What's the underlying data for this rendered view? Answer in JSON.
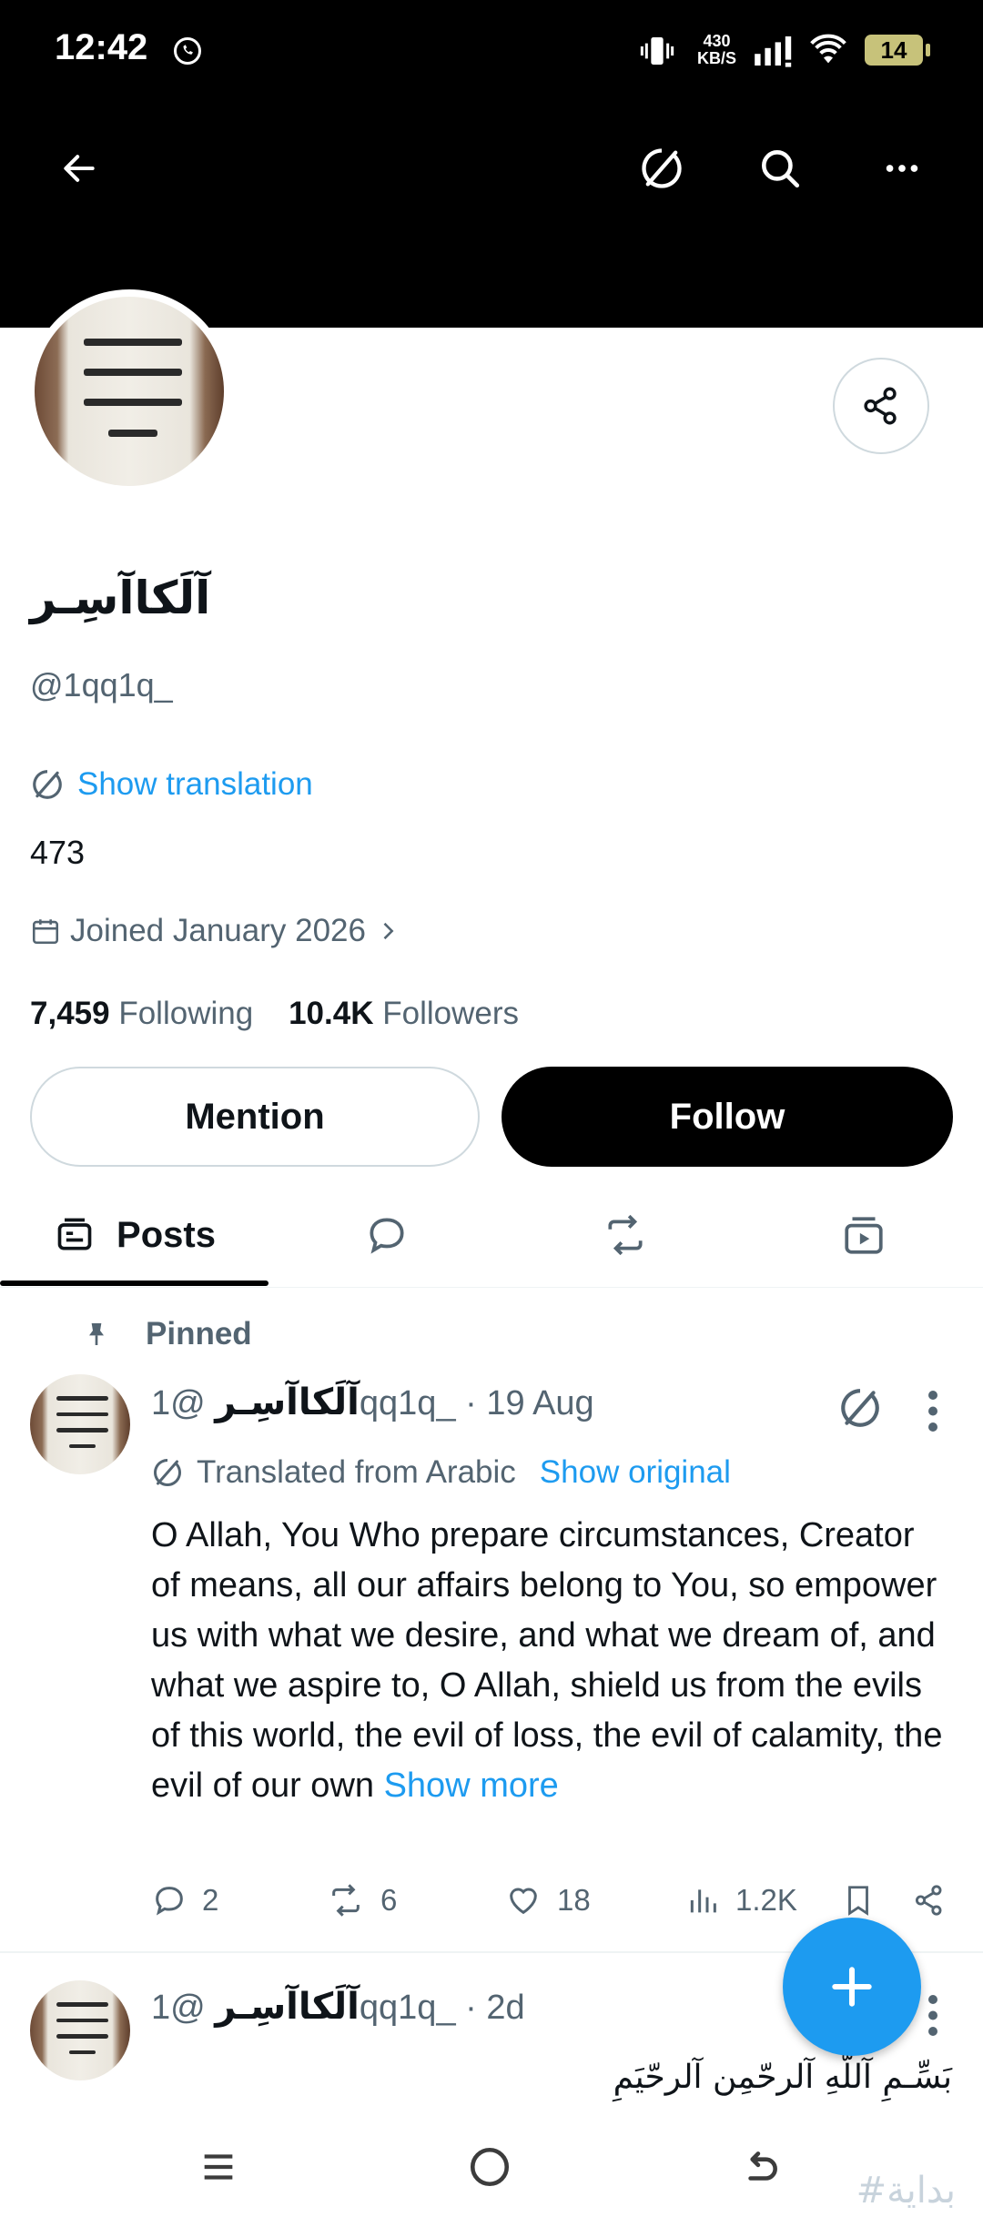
{
  "status_bar": {
    "time": "12:42",
    "net_speed_value": "430",
    "net_speed_unit": "KB/S",
    "battery": "14"
  },
  "profile": {
    "display_name": "آلَكاآسِـر",
    "handle": "@1qq1q_",
    "show_translation": "Show translation",
    "bio": "473",
    "joined": "Joined January 2026",
    "following_count": "7,459",
    "following_label": "Following",
    "followers_count": "10.4K",
    "followers_label": "Followers"
  },
  "buttons": {
    "mention": "Mention",
    "follow": "Follow"
  },
  "tabs": {
    "posts": "Posts"
  },
  "pinned_label": "Pinned",
  "post1": {
    "name": "آلَكاآسِـر",
    "meta": "@1qq1q_ · 19 Aug",
    "translated_from": "Translated from Arabic",
    "show_original": "Show original",
    "text": "O Allah, You Who prepare circumstances, Creator of means, all our affairs belong to You, so empower us with what we desire, and what we dream of, and what we aspire to, O Allah, shield us from the evils of this world, the evil of loss, the evil of calamity, the evil of our own ",
    "show_more": "Show more",
    "replies": "2",
    "reposts": "6",
    "likes": "18",
    "views": "1.2K"
  },
  "post2": {
    "name": "آلَكاآسِـر",
    "meta": "@1qq1q_ · 2d",
    "text": "بَسِّـمِ آللّهِ آلرحّمِن آلرحّيَمِ"
  },
  "watermark": "#بداية",
  "colors": {
    "accent": "#1d9bf0",
    "text": "#0f1419",
    "muted": "#536471",
    "header_bg": "#000000"
  }
}
